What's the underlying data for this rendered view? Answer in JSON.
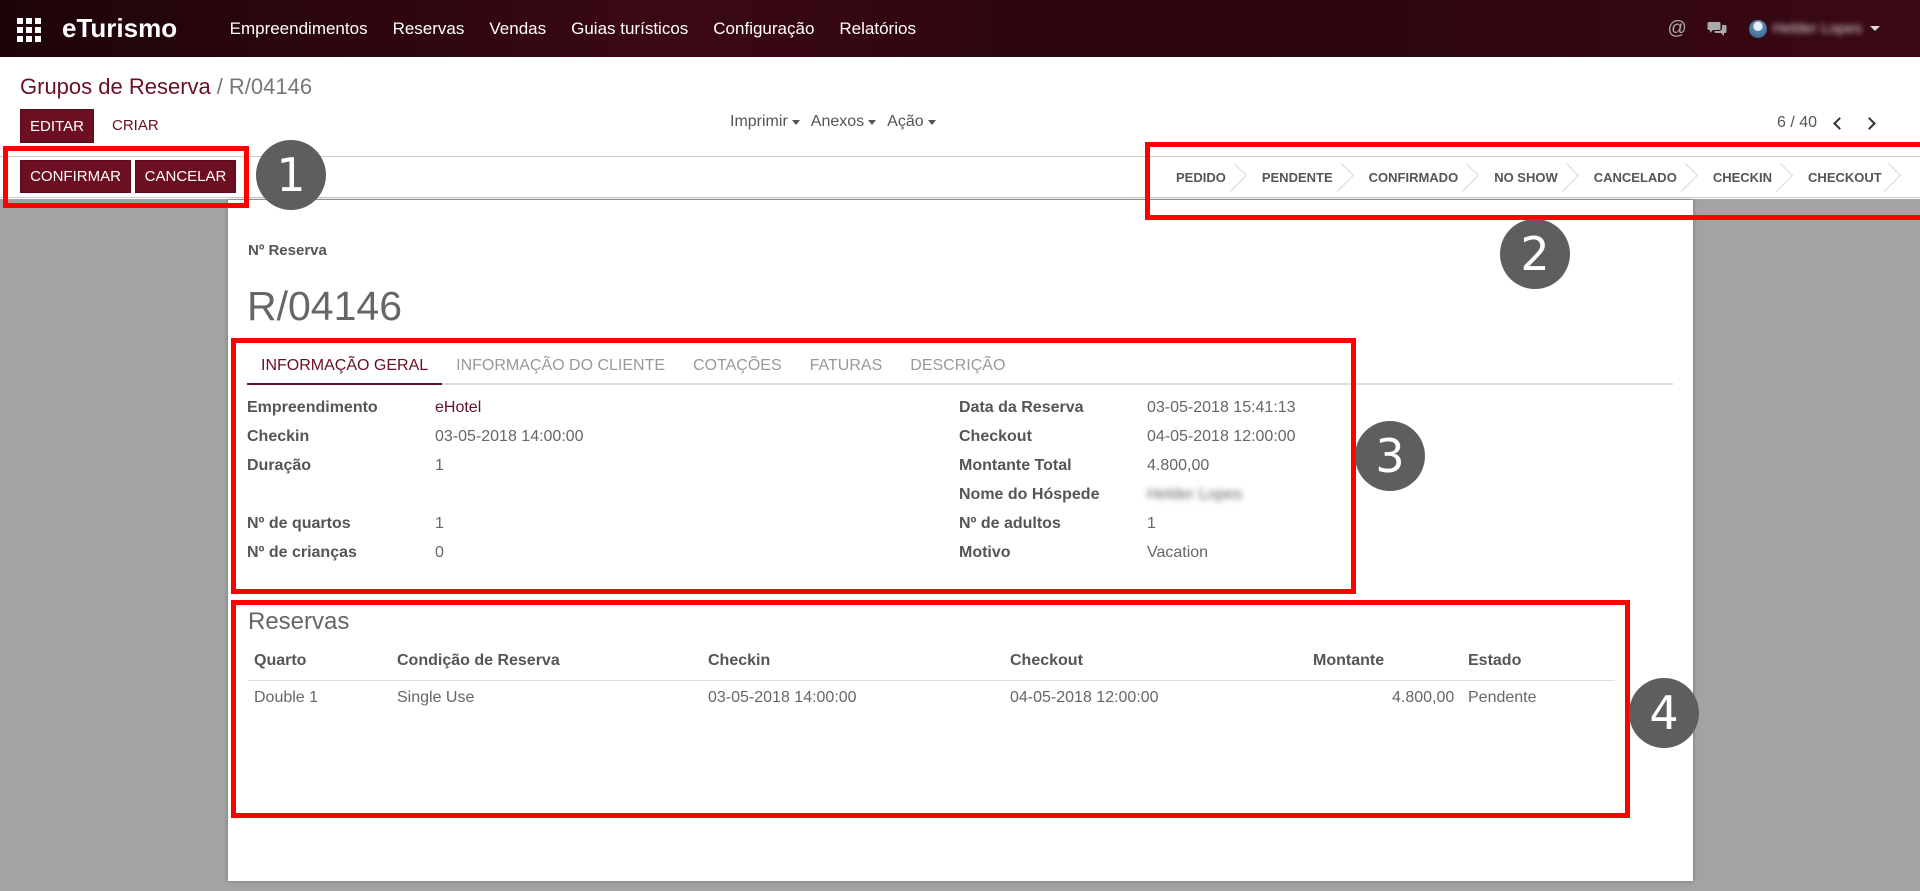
{
  "navbar": {
    "brand": "eTurismo",
    "menu": [
      "Empreendimentos",
      "Reservas",
      "Vendas",
      "Guias turísticos",
      "Configuração",
      "Relatórios"
    ],
    "at_symbol": "@",
    "user_name": "Helder Lopes"
  },
  "breadcrumb": {
    "parent": "Grupos de Reserva",
    "separator": "/",
    "current": "R/04146"
  },
  "buttons": {
    "edit": "EDITAR",
    "create": "CRIAR",
    "confirm": "CONFIRMAR",
    "cancel": "CANCELAR"
  },
  "sidebar_menus": [
    "Imprimir",
    "Anexos",
    "Ação"
  ],
  "pager": {
    "value": "6 / 40"
  },
  "statusbar": [
    "PEDIDO",
    "PENDENTE",
    "CONFIRMADO",
    "NO SHOW",
    "CANCELADO",
    "CHECKIN",
    "CHECKOUT"
  ],
  "record": {
    "ref_label": "Nº Reserva",
    "ref_value": "R/04146"
  },
  "tabs": [
    "INFORMAÇÃO GERAL",
    "INFORMAÇÃO DO CLIENTE",
    "COTAÇÕES",
    "FATURAS",
    "DESCRIÇÃO"
  ],
  "fields_left": [
    {
      "label": "Empreendimento",
      "value": "eHotel"
    },
    {
      "label": "Checkin",
      "value": "03-05-2018 14:00:00"
    },
    {
      "label": "Duração",
      "value": "1"
    },
    {
      "label": "Nº de quartos",
      "value": "1"
    },
    {
      "label": "Nº de crianças",
      "value": "0"
    }
  ],
  "fields_right": [
    {
      "label": "Data da Reserva",
      "value": "03-05-2018 15:41:13"
    },
    {
      "label": "Checkout",
      "value": "04-05-2018 12:00:00"
    },
    {
      "label": "Montante Total",
      "value": "4.800,00"
    },
    {
      "label": "Nome do Hóspede",
      "value": "Helder Lopes"
    },
    {
      "label": "Nº de adultos",
      "value": "1"
    },
    {
      "label": "Motivo",
      "value": "Vacation"
    }
  ],
  "reservas": {
    "title": "Reservas",
    "columns": [
      "Quarto",
      "Condição de Reserva",
      "Checkin",
      "Checkout",
      "Montante",
      "Estado"
    ],
    "rows": [
      [
        "Double 1",
        "Single Use",
        "03-05-2018 14:00:00",
        "04-05-2018 12:00:00",
        "4.800,00",
        "Pendente"
      ]
    ]
  },
  "annotations": [
    "1",
    "2",
    "3",
    "4"
  ],
  "colors": {
    "brand": "#6d0f22",
    "navbar": "#2b060f",
    "annotation": "#ff0000"
  }
}
